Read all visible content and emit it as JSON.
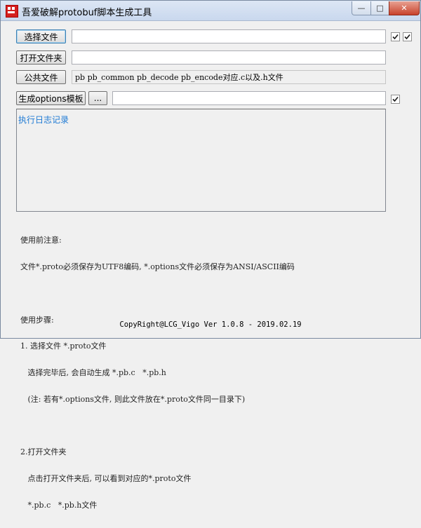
{
  "window": {
    "title": "吾爱破解protobuf脚本生成工具",
    "controls": {
      "minimize": "—",
      "maximize": "□",
      "close": "✕"
    }
  },
  "row_select": {
    "button_label": "选择文件",
    "input_value": "",
    "checkbox_1_checked": true,
    "checkbox_2_checked": true
  },
  "row_folder": {
    "button_label": "打开文件夹",
    "input_value": ""
  },
  "row_common": {
    "button_label": "公共文件",
    "field_text": "pb  pb_common  pb_decode  pb_encode对应.c以及.h文件"
  },
  "row_template": {
    "button_label": "生成options模板",
    "browse_label": "...",
    "input_value": "",
    "checkbox_checked": true
  },
  "log": {
    "placeholder": "执行日志记录"
  },
  "notes": {
    "lines": [
      "使用前注意:",
      "文件*.proto必须保存为UTF8编码, *.options文件必须保存为ANSI/ASCII编码",
      "",
      "使用步骤:",
      "1. 选择文件 *.proto文件",
      "   选择完毕后, 会自动生成 *.pb.c   *.pb.h",
      "   (注: 若有*.options文件, 则此文件放在*.proto文件同一目录下)",
      "",
      "2.打开文件夹",
      "   点击打开文件夹后, 可以看到对应的*.proto文件",
      "   *.pb.c   *.pb.h文件"
    ]
  },
  "footer": {
    "text": "CopyRight@LCG_Vigo  Ver 1.0.8 - 2019.02.19"
  },
  "colors": {
    "log_text": "#1e7ad4",
    "close_button": "#c8422c",
    "titlebar": "#dce6f4"
  }
}
